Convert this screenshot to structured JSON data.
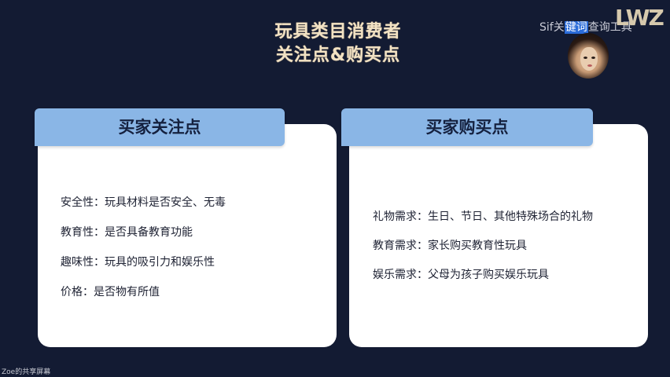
{
  "title": {
    "line1": "玩具类目消费者",
    "line2": "关注点&购买点"
  },
  "watermark": {
    "prefix": "Sif关",
    "highlight": "键词",
    "suffix": "查询工具",
    "logo": "LWZ"
  },
  "left_card": {
    "header": "买家关注点",
    "items": [
      "安全性：玩具材料是否安全、无毒",
      "教育性：是否具备教育功能",
      "趣味性：玩具的吸引力和娱乐性",
      "价格：是否物有所值"
    ]
  },
  "right_card": {
    "header": "买家购买点",
    "items": [
      "礼物需求：生日、节日、其他特殊场合的礼物",
      "教育需求：家长购买教育性玩具",
      "娱乐需求：父母为孩子购买娱乐玩具"
    ]
  },
  "caption": "Zoe的共享屏幕",
  "colors": {
    "background": "#131b33",
    "header": "#8ab6e6",
    "title": "#f2e2c4",
    "card": "#ffffff"
  }
}
